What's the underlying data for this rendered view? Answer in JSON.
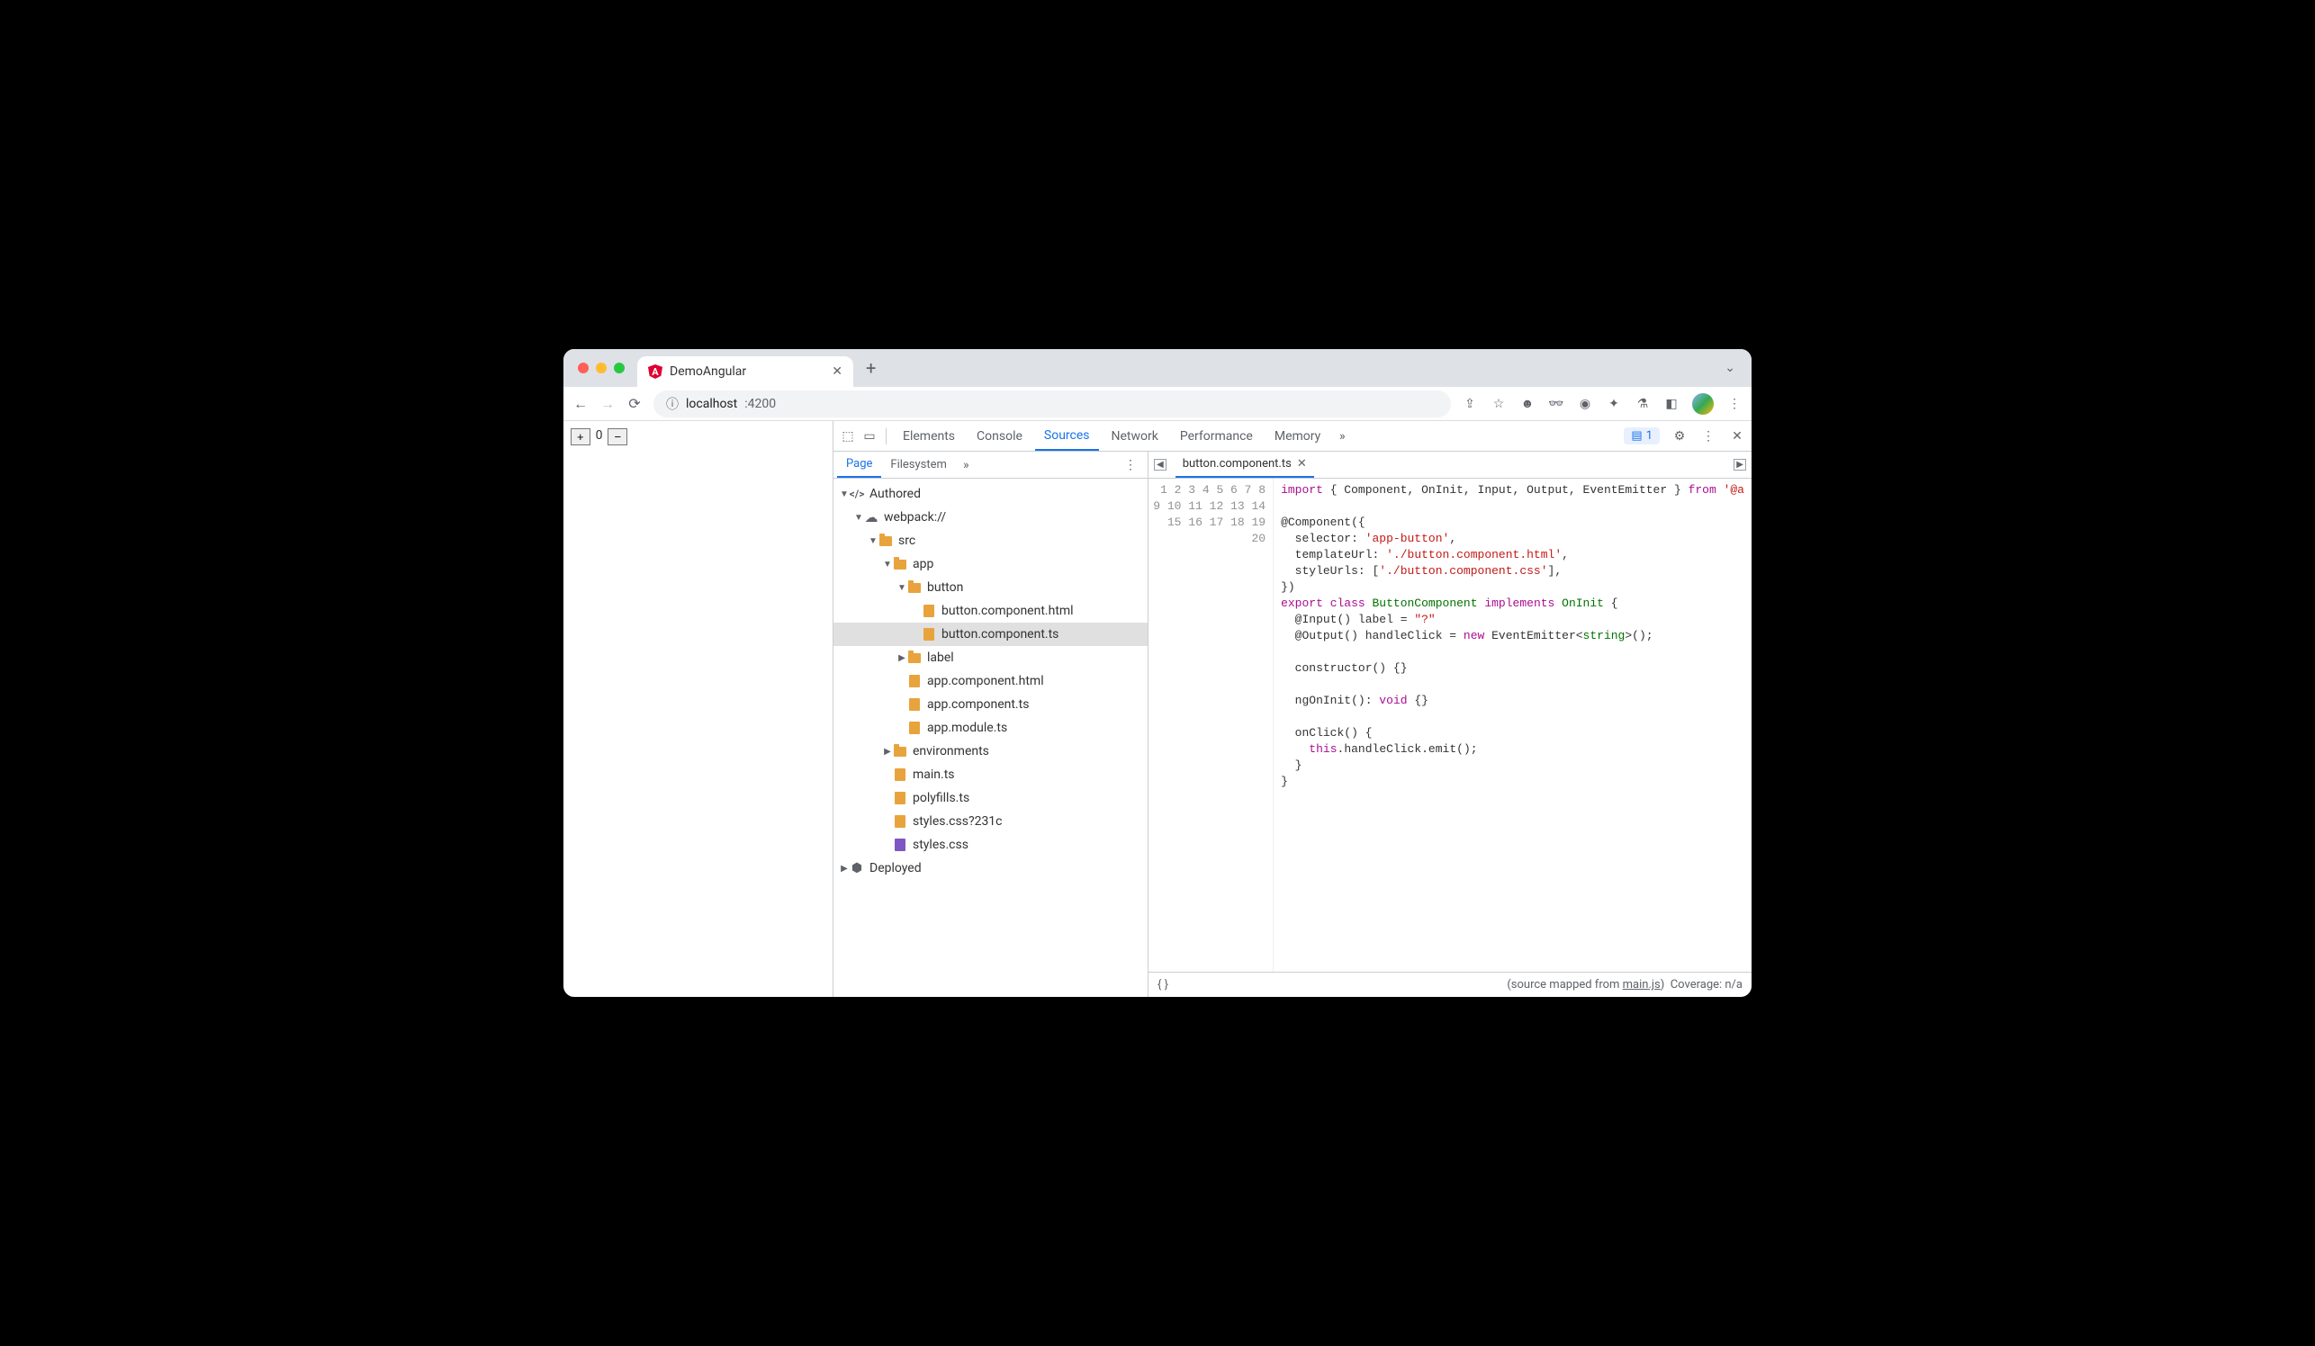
{
  "browser": {
    "tab_title": "DemoAngular",
    "url_prefix": "localhost",
    "url_port": ":4200",
    "chevron": "⌄"
  },
  "page": {
    "plus": "+",
    "count": "0",
    "minus": "−"
  },
  "devtools": {
    "tabs": [
      "Elements",
      "Console",
      "Sources",
      "Network",
      "Performance",
      "Memory"
    ],
    "active_tab_index": 2,
    "issues_count": "1"
  },
  "navigator": {
    "tabs": [
      "Page",
      "Filesystem"
    ],
    "active_tab_index": 0,
    "tree": {
      "authored": "Authored",
      "webpack": "webpack://",
      "src": "src",
      "app": "app",
      "button": "button",
      "button_html": "button.component.html",
      "button_ts": "button.component.ts",
      "label": "label",
      "app_html": "app.component.html",
      "app_ts": "app.component.ts",
      "app_module": "app.module.ts",
      "environments": "environments",
      "main_ts": "main.ts",
      "polyfills": "polyfills.ts",
      "styles_q": "styles.css?231c",
      "styles": "styles.css",
      "deployed": "Deployed"
    }
  },
  "editor": {
    "filename": "button.component.ts",
    "line_count": 20,
    "code": {
      "l1_import": "import",
      "l1_braces": " { Component, OnInit, Input, Output, EventEmitter } ",
      "l1_from": "from",
      "l1_pkg": " '@a",
      "l3": "@Component({",
      "l4a": "  selector: ",
      "l4b": "'app-button'",
      "l4c": ",",
      "l5a": "  templateUrl: ",
      "l5b": "'./button.component.html'",
      "l5c": ",",
      "l6a": "  styleUrls: [",
      "l6b": "'./button.component.css'",
      "l6c": "],",
      "l7": "})",
      "l8_export": "export",
      "l8_class": " class ",
      "l8_name": "ButtonComponent",
      "l8_impl": " implements ",
      "l8_oninit": "OnInit",
      "l8_brace": " {",
      "l9a": "  @Input() label = ",
      "l9b": "\"?\"",
      "l10a": "  @Output() handleClick = ",
      "l10_new": "new",
      "l10b": " EventEmitter<",
      "l10_str": "string",
      "l10c": ">();",
      "l12": "  constructor() {}",
      "l14a": "  ngOnInit(): ",
      "l14_void": "void",
      "l14b": " {}",
      "l16": "  onClick() {",
      "l17a": "    ",
      "l17_this": "this",
      "l17b": ".handleClick.emit();",
      "l18": "  }",
      "l19": "}"
    }
  },
  "statusbar": {
    "braces": "{ }",
    "mapped_prefix": "(source mapped from ",
    "mapped_link": "main.js",
    "mapped_suffix": ")",
    "coverage": "Coverage: n/a"
  }
}
